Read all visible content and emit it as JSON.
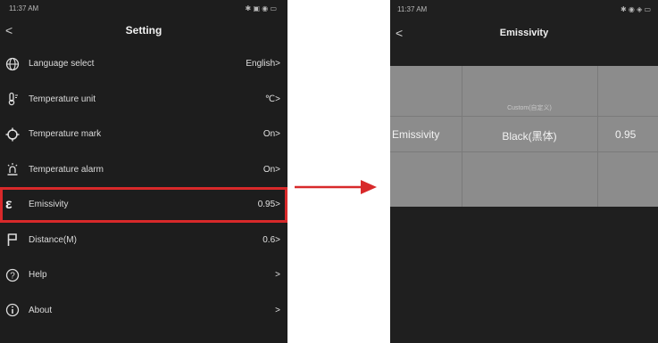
{
  "left_screen": {
    "status_time": "11:37 AM",
    "status_icons": "✱ ▣ ◉ ▭",
    "back": "<",
    "title": "Setting",
    "items": [
      {
        "label": "Language select",
        "value": "English>",
        "icon": "globe-icon"
      },
      {
        "label": "Temperature unit",
        "value": "℃>",
        "icon": "thermometer-icon"
      },
      {
        "label": "Temperature mark",
        "value": "On>",
        "icon": "crosshair-icon"
      },
      {
        "label": "Temperature alarm",
        "value": "On>",
        "icon": "alarm-icon"
      },
      {
        "label": "Emissivity",
        "value": "0.95>",
        "icon": "epsilon-icon",
        "highlighted": true
      },
      {
        "label": "Distance(M)",
        "value": "0.6>",
        "icon": "flag-icon"
      },
      {
        "label": "Help",
        "value": ">",
        "icon": "question-icon"
      },
      {
        "label": "About",
        "value": ">",
        "icon": "info-icon"
      }
    ]
  },
  "right_screen": {
    "status_time": "11:37 AM",
    "status_icons": "✱ ◉ ◈ ▭",
    "back": "<",
    "title": "Emissivity",
    "picker": {
      "custom_label": "Custom(自定义)",
      "left": "Emissivity",
      "middle": "Black(黑体)",
      "right": "0.95"
    }
  },
  "colors": {
    "highlight": "#d8292a",
    "arrow": "#d8292a"
  }
}
